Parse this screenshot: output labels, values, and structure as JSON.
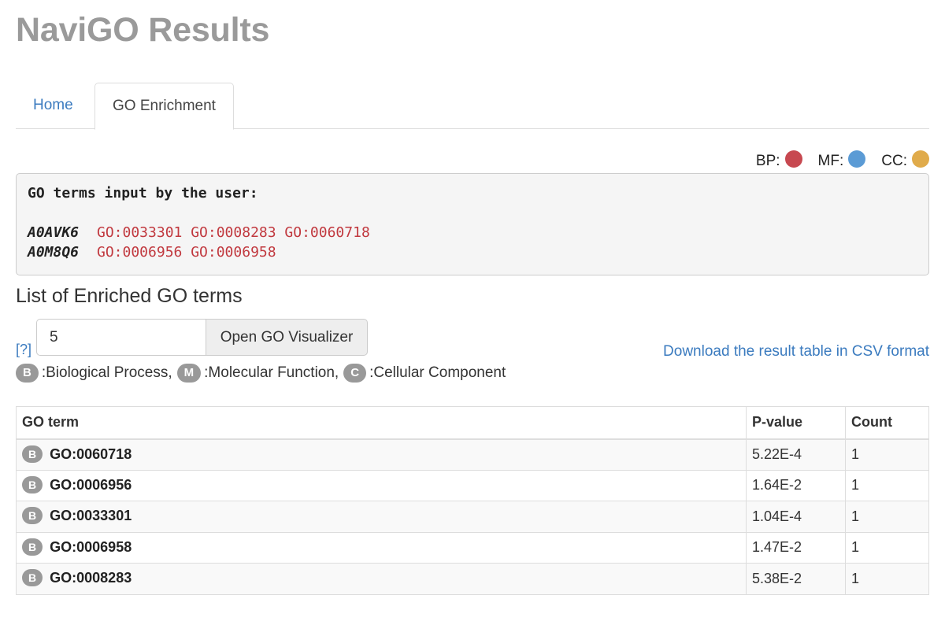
{
  "page_title": "NaviGO Results",
  "tabs": [
    {
      "label": "Home",
      "active": false
    },
    {
      "label": "GO Enrichment",
      "active": true
    }
  ],
  "legend": [
    {
      "label": "BP:",
      "color": "#c74850"
    },
    {
      "label": "MF:",
      "color": "#5b9bd5"
    },
    {
      "label": "CC:",
      "color": "#e0ab4b"
    }
  ],
  "user_input": {
    "header": "GO terms input by the user:",
    "genes": [
      {
        "name": "A0AVK6",
        "terms": "GO:0033301 GO:0008283 GO:0060718"
      },
      {
        "name": "A0M8Q6",
        "terms": "GO:0006956 GO:0006958"
      }
    ]
  },
  "section_title": "List of Enriched GO terms",
  "help_link": "[?]",
  "visualizer": {
    "input_value": "5",
    "button_label": "Open GO Visualizer"
  },
  "csv_link": "Download the result table in CSV format",
  "category_key": [
    {
      "badge": "B",
      "label": ":Biological Process,"
    },
    {
      "badge": "M",
      "label": ":Molecular Function,"
    },
    {
      "badge": "C",
      "label": ":Cellular Component"
    }
  ],
  "table": {
    "headers": [
      "GO term",
      "P-value",
      "Count"
    ],
    "rows": [
      {
        "badge": "B",
        "term": "GO:0060718",
        "pvalue": "5.22E-4",
        "count": "1"
      },
      {
        "badge": "B",
        "term": "GO:0006956",
        "pvalue": "1.64E-2",
        "count": "1"
      },
      {
        "badge": "B",
        "term": "GO:0033301",
        "pvalue": "1.04E-4",
        "count": "1"
      },
      {
        "badge": "B",
        "term": "GO:0006958",
        "pvalue": "1.47E-2",
        "count": "1"
      },
      {
        "badge": "B",
        "term": "GO:0008283",
        "pvalue": "5.38E-2",
        "count": "1"
      }
    ]
  }
}
